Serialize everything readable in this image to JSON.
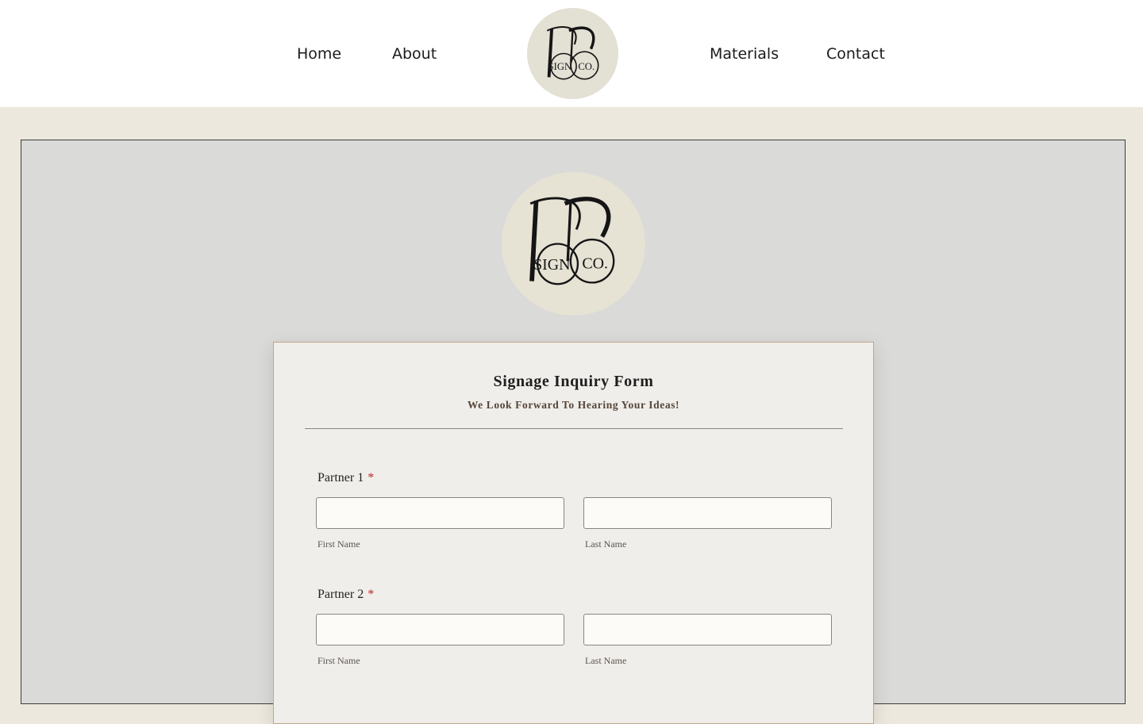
{
  "nav": {
    "items": [
      {
        "label": "Home"
      },
      {
        "label": "About"
      },
      {
        "label": "Materials"
      },
      {
        "label": "Contact"
      }
    ],
    "logo_icon": "bb-sign-co-monogram-logo"
  },
  "logo": {
    "text_sign": "SIGN",
    "text_co": "CO."
  },
  "form": {
    "title": "Signage Inquiry Form",
    "subtitle": "We Look Forward To Hearing Your Ideas!",
    "required_marker": "*",
    "fields": [
      {
        "label": "Partner 1",
        "first_sublabel": "First Name",
        "last_sublabel": "Last Name",
        "first_value": "",
        "last_value": ""
      },
      {
        "label": "Partner 2",
        "first_sublabel": "First Name",
        "last_sublabel": "Last Name",
        "first_value": "",
        "last_value": ""
      }
    ]
  },
  "colors": {
    "page_background": "#ede8dd",
    "header_background": "#ffffff",
    "frame_background": "#dadad8",
    "logo_circle": "#e3e0d4",
    "card_background": "#f0eeea",
    "card_border": "#c2a68c",
    "required_asterisk": "#b8262c"
  }
}
